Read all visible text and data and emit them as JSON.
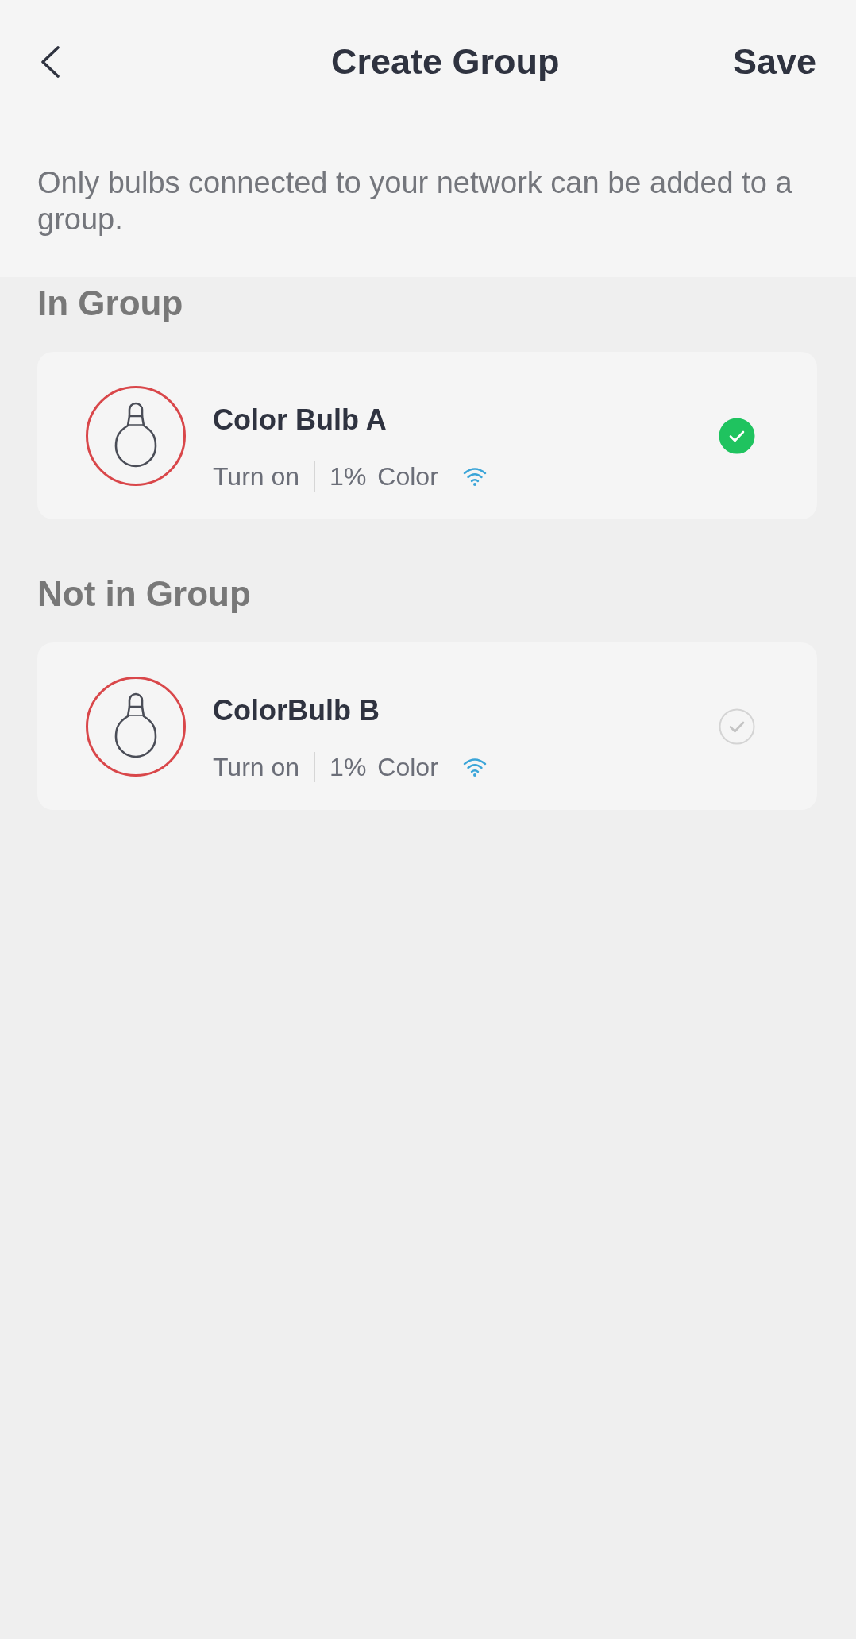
{
  "header": {
    "title": "Create Group",
    "save_label": "Save"
  },
  "notice": "Only bulbs connected to your network can be added to a group.",
  "sections": [
    {
      "title": "In Group",
      "devices": [
        {
          "name": "Color Bulb A",
          "power_action": "Turn on",
          "brightness": "1%",
          "mode": "Color",
          "selected": true
        }
      ]
    },
    {
      "title": "Not in Group",
      "devices": [
        {
          "name": "ColorBulb B",
          "power_action": "Turn on",
          "brightness": "1%",
          "mode": "Color",
          "selected": false
        }
      ]
    }
  ]
}
